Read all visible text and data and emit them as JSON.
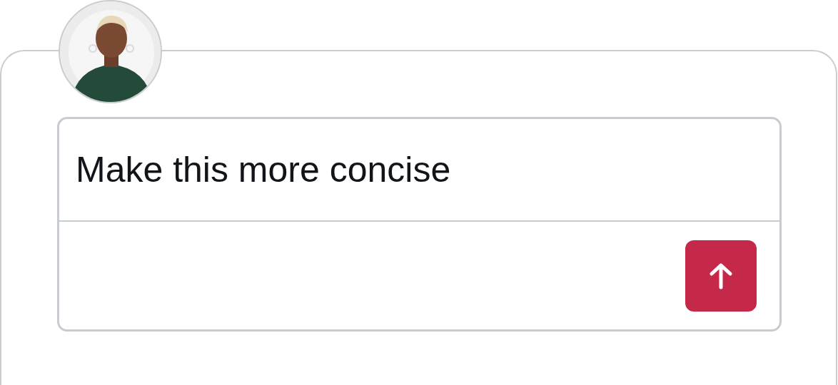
{
  "prompt": {
    "value": "Make this more concise"
  }
}
